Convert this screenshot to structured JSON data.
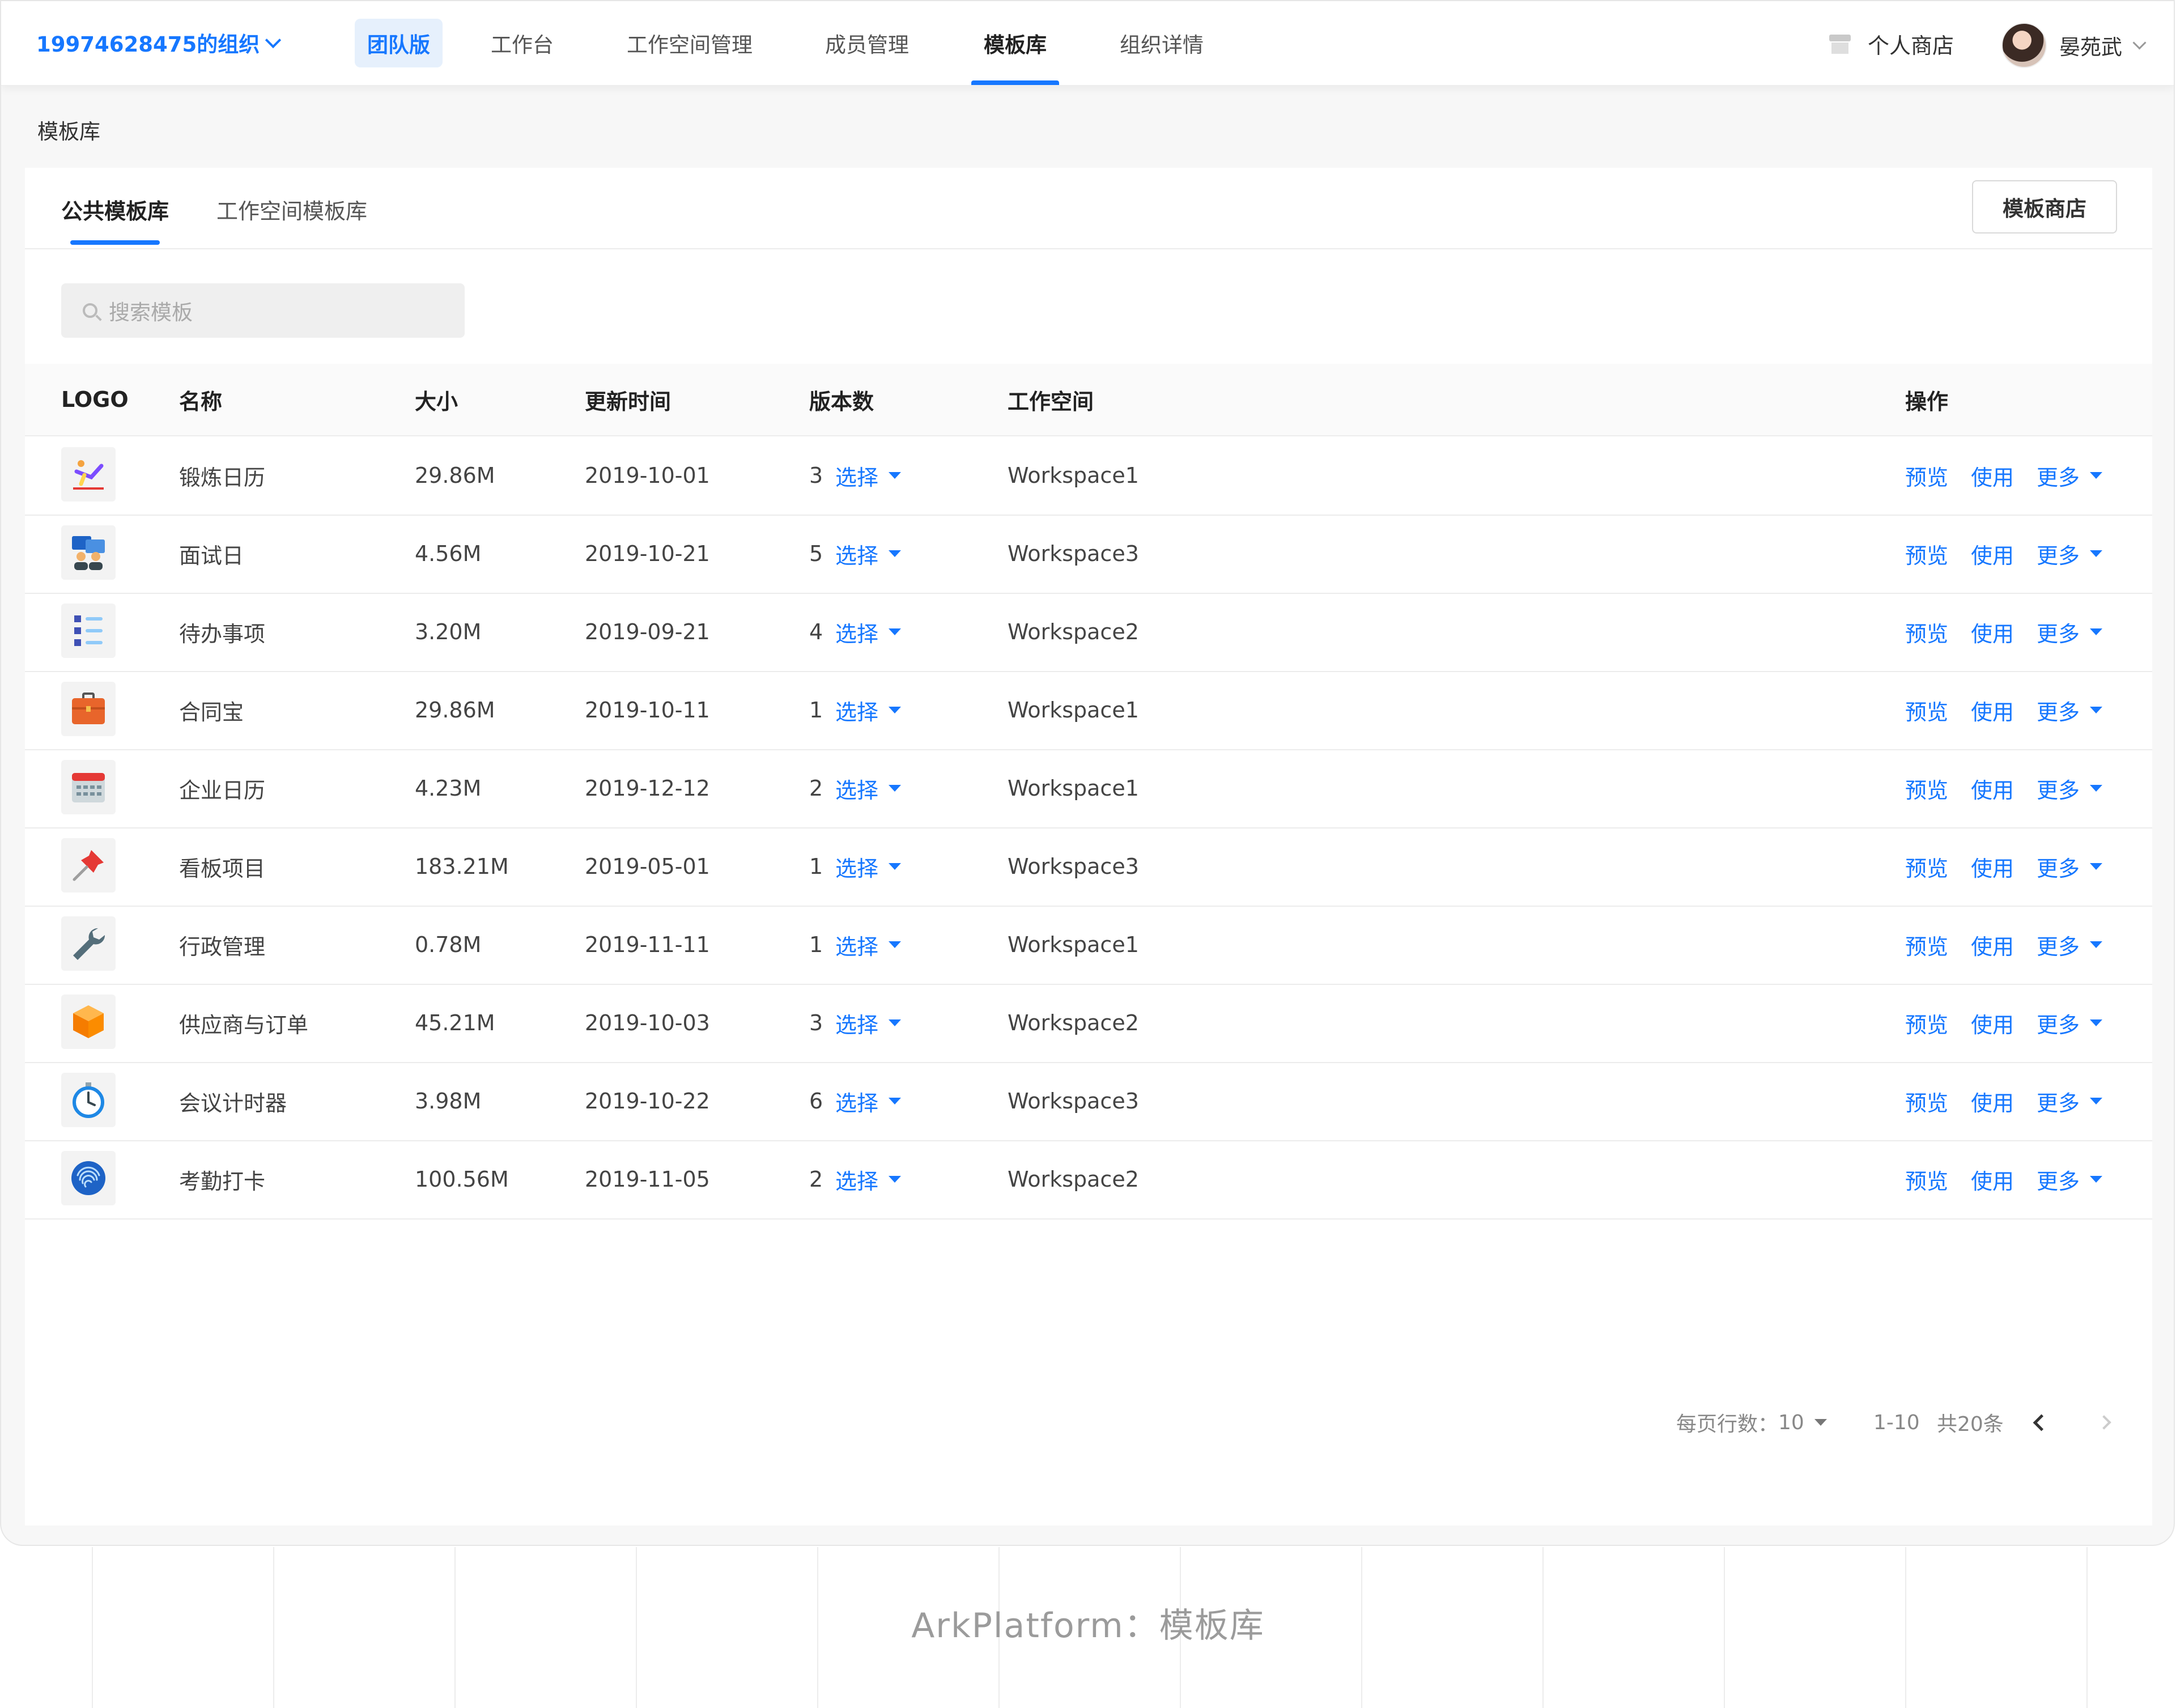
{
  "header": {
    "org_name": "19974628475的组织",
    "nav": [
      "团队版",
      "工作台",
      "工作空间管理",
      "成员管理",
      "模板库",
      "组织详情"
    ],
    "shop_label": "个人商店",
    "user_name": "晏苑武"
  },
  "breadcrumb": "模板库",
  "tabs": [
    "公共模板库",
    "工作空间模板库"
  ],
  "store_button": "模板商店",
  "search": {
    "placeholder": "搜索模板"
  },
  "table": {
    "columns": [
      "LOGO",
      "名称",
      "大小",
      "更新时间",
      "版本数",
      "工作空间",
      "操作"
    ],
    "select_label": "选择",
    "actions": {
      "preview": "预览",
      "use": "使用",
      "more": "更多"
    },
    "rows": [
      {
        "icon": "exercise-icon",
        "name": "锻炼日历",
        "size": "29.86M",
        "updated": "2019-10-01",
        "versions": "3",
        "workspace": "Workspace1"
      },
      {
        "icon": "interview-icon",
        "name": "面试日",
        "size": "4.56M",
        "updated": "2019-10-21",
        "versions": "5",
        "workspace": "Workspace3"
      },
      {
        "icon": "todo-list-icon",
        "name": "待办事项",
        "size": "3.20M",
        "updated": "2019-09-21",
        "versions": "4",
        "workspace": "Workspace2"
      },
      {
        "icon": "briefcase-icon",
        "name": "合同宝",
        "size": "29.86M",
        "updated": "2019-10-11",
        "versions": "1",
        "workspace": "Workspace1"
      },
      {
        "icon": "calendar-icon",
        "name": "企业日历",
        "size": "4.23M",
        "updated": "2019-12-12",
        "versions": "2",
        "workspace": "Workspace1"
      },
      {
        "icon": "pushpin-icon",
        "name": "看板项目",
        "size": "183.21M",
        "updated": "2019-05-01",
        "versions": "1",
        "workspace": "Workspace3"
      },
      {
        "icon": "wrench-icon",
        "name": "行政管理",
        "size": "0.78M",
        "updated": "2019-11-11",
        "versions": "1",
        "workspace": "Workspace1"
      },
      {
        "icon": "package-box-icon",
        "name": "供应商与订单",
        "size": "45.21M",
        "updated": "2019-10-03",
        "versions": "3",
        "workspace": "Workspace2"
      },
      {
        "icon": "stopwatch-icon",
        "name": "会议计时器",
        "size": "3.98M",
        "updated": "2019-10-22",
        "versions": "6",
        "workspace": "Workspace3"
      },
      {
        "icon": "fingerprint-icon",
        "name": "考勤打卡",
        "size": "100.56M",
        "updated": "2019-11-05",
        "versions": "2",
        "workspace": "Workspace2"
      }
    ]
  },
  "pagination": {
    "rows_per_page_label": "每页行数：",
    "rows_per_page": "10",
    "range": "1-10",
    "total": "共20条"
  },
  "caption": "ArkPlatform：模板库",
  "colors": {
    "accent": "#1677ff",
    "text": "#333333",
    "muted": "#888888"
  }
}
